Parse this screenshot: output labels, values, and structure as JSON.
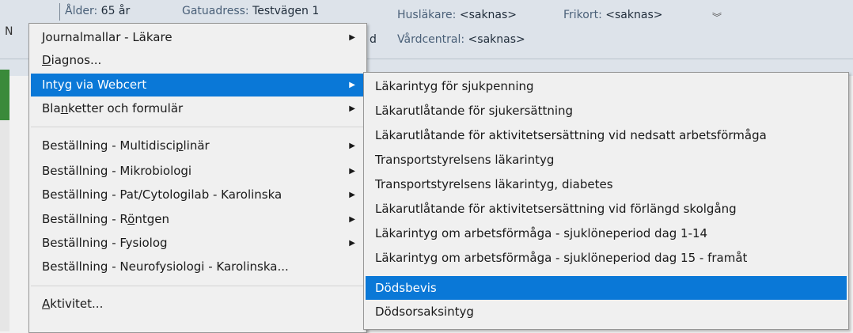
{
  "header": {
    "alder_label": "Ålder:",
    "alder_value": "65 år",
    "gatuadress_label": "Gatuadress:",
    "gatuadress_value": "Testvägen 1",
    "huslakare_label": "Husläkare:",
    "huslakare_value": "<saknas>",
    "frikort_label": "Frikort:",
    "frikort_value": "<saknas>",
    "vardcentral_label": "Vårdcentral:",
    "vardcentral_value": "<saknas>",
    "left_char": "N",
    "clipped_char": "d"
  },
  "main_menu": {
    "items": [
      {
        "label": "Journalmallar - Läkare",
        "has_submenu": true
      },
      {
        "label_pre": "",
        "label_ul": "D",
        "label_post": "iagnos...",
        "has_submenu": false
      },
      {
        "label": "Intyg via Webcert",
        "has_submenu": true,
        "highlighted": true
      },
      {
        "label_pre": "Bla",
        "label_ul": "n",
        "label_post": "ketter och formulär",
        "has_submenu": true
      },
      {
        "label_pre": "Beställning - Multidisci",
        "label_ul": "p",
        "label_post": "linär",
        "has_submenu": true
      },
      {
        "label": "Beställning - Mikrobiologi",
        "has_submenu": true
      },
      {
        "label": "Beställning - Pat/Cytologilab - Karolinska",
        "has_submenu": true
      },
      {
        "label_pre": "Beställning - R",
        "label_ul": "ö",
        "label_post": "ntgen",
        "has_submenu": true
      },
      {
        "label": "Beställning - Fysiolog",
        "has_submenu": true
      },
      {
        "label": "Beställning - Neurofysiologi - Karolinska...",
        "has_submenu": false
      },
      {
        "label_pre": "",
        "label_ul": "A",
        "label_post": "ktivitet...",
        "has_submenu": false
      }
    ]
  },
  "submenu": {
    "items": [
      "Läkarintyg för sjukpenning",
      "Läkarutlåtande för sjukersättning",
      "Läkarutlåtande för aktivitetsersättning vid nedsatt arbetsförmåga",
      "Transportstyrelsens läkarintyg",
      "Transportstyrelsens läkarintyg, diabetes",
      "Läkarutlåtande för aktivitetsersättning vid förlängd skolgång",
      "Läkarintyg om arbetsförmåga - sjuklöneperiod dag 1-14",
      "Läkarintyg om arbetsförmåga - sjuklöneperiod dag 15 - framåt",
      "Dödsbevis",
      "Dödsorsaksintyg"
    ],
    "highlighted": "Dödsbevis"
  },
  "colors": {
    "highlight": "#0a78d7",
    "menu_bg": "#f0f0f0",
    "header_bg": "#dde3ea",
    "status_green": "#3a8a3a"
  },
  "icons": {
    "submenu_arrow": "submenu-arrow-icon",
    "expand": "double-chevron-down-icon"
  }
}
